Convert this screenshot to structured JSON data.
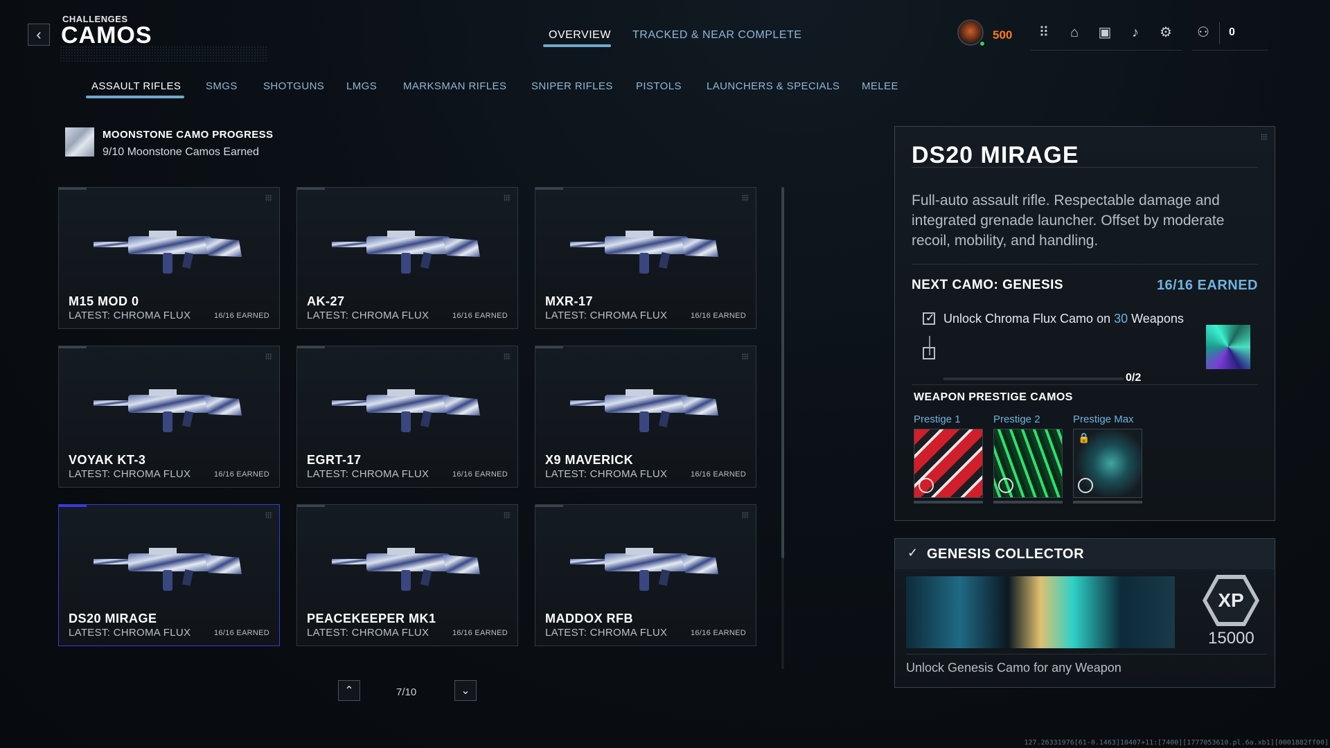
{
  "header": {
    "breadcrumb": "CHALLENGES",
    "title": "CAMOS",
    "tabs": [
      {
        "label": "OVERVIEW",
        "active": true
      },
      {
        "label": "TRACKED & NEAR COMPLETE",
        "active": false
      }
    ]
  },
  "hud": {
    "cp_value": "500",
    "party_count": "0",
    "icons": [
      "grid-icon",
      "lock-icon",
      "camera-icon",
      "bell-icon",
      "gear-icon",
      "party-icon"
    ]
  },
  "categories": [
    {
      "label": "ASSAULT RIFLES",
      "active": true
    },
    {
      "label": "SMGS"
    },
    {
      "label": "SHOTGUNS"
    },
    {
      "label": "LMGS"
    },
    {
      "label": "MARKSMAN RIFLES"
    },
    {
      "label": "SNIPER RIFLES"
    },
    {
      "label": "PISTOLS"
    },
    {
      "label": "LAUNCHERS & SPECIALS"
    },
    {
      "label": "MELEE"
    }
  ],
  "moonstone": {
    "title": "MOONSTONE CAMO PROGRESS",
    "subtitle": "9/10 Moonstone Camos Earned"
  },
  "weapons": [
    {
      "name": "M15 MOD 0",
      "latest": "LATEST: CHROMA FLUX",
      "earned": "16/16 EARNED"
    },
    {
      "name": "AK-27",
      "latest": "LATEST: CHROMA FLUX",
      "earned": "16/16 EARNED"
    },
    {
      "name": "MXR-17",
      "latest": "LATEST: CHROMA FLUX",
      "earned": "16/16 EARNED"
    },
    {
      "name": "VOYAK KT-3",
      "latest": "LATEST: CHROMA FLUX",
      "earned": "16/16 EARNED"
    },
    {
      "name": "EGRT-17",
      "latest": "LATEST: CHROMA FLUX",
      "earned": "16/16 EARNED"
    },
    {
      "name": "X9 MAVERICK",
      "latest": "LATEST: CHROMA FLUX",
      "earned": "16/16 EARNED"
    },
    {
      "name": "DS20 MIRAGE",
      "latest": "LATEST: CHROMA FLUX",
      "earned": "16/16 EARNED",
      "selected": true
    },
    {
      "name": "PEACEKEEPER MK1",
      "latest": "LATEST: CHROMA FLUX",
      "earned": "16/16 EARNED"
    },
    {
      "name": "MADDOX RFB",
      "latest": "LATEST: CHROMA FLUX",
      "earned": "16/16 EARNED"
    }
  ],
  "pager": {
    "text": "7/10"
  },
  "detail": {
    "title": "DS20 MIRAGE",
    "description": "Full-auto assault rifle. Respectable damage and integrated grenade launcher. Offset by moderate recoil, mobility, and handling.",
    "next_camo": "NEXT CAMO: GENESIS",
    "next_earned": "16/16 EARNED",
    "task_prefix": "Unlock Chroma Flux Camo on ",
    "task_number": "30",
    "task_suffix": " Weapons",
    "progress": "0/2",
    "progress_fraction": 0,
    "prestige_title": "WEAPON PRESTIGE CAMOS",
    "prestige": [
      {
        "label": "Prestige 1",
        "locked": false
      },
      {
        "label": "Prestige 2",
        "locked": false
      },
      {
        "label": "Prestige Max",
        "locked": true
      }
    ]
  },
  "collector": {
    "title": "GENESIS COLLECTOR",
    "xp_label": "XP",
    "xp_value": "15000",
    "description": "Unlock Genesis Camo for any Weapon"
  },
  "build_id": "127.26331976[61-0.1463]10407+11:[7400][1777053610.pl.6a.xb1][0001882ff00]",
  "colors": {
    "accent": "#6fb3e0",
    "cp": "#ff7a1a",
    "selected_border": "#3b3ad8"
  }
}
